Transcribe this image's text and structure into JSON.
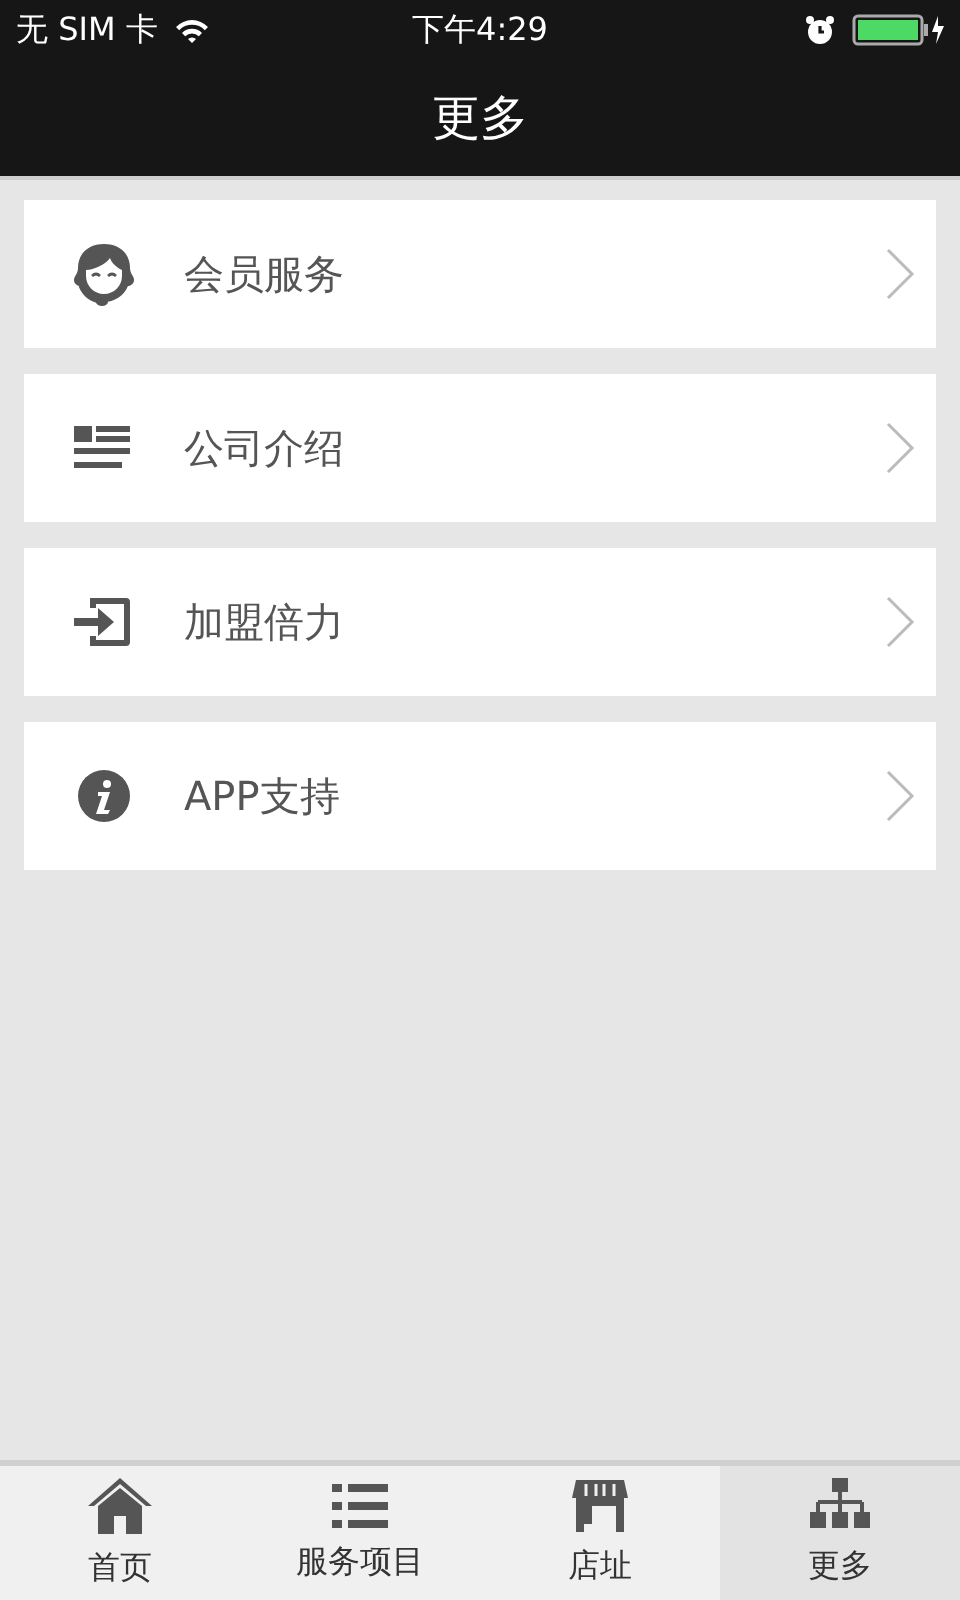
{
  "status_bar": {
    "carrier": "无 SIM 卡",
    "time": "下午4:29"
  },
  "header": {
    "title": "更多"
  },
  "menu_items": [
    {
      "label": "会员服务"
    },
    {
      "label": "公司介绍"
    },
    {
      "label": "加盟倍力"
    },
    {
      "label": "APP支持"
    }
  ],
  "tab_bar": [
    {
      "label": "首页",
      "selected": false
    },
    {
      "label": "服务项目",
      "selected": false
    },
    {
      "label": "店址",
      "selected": false
    },
    {
      "label": "更多",
      "selected": true
    }
  ]
}
